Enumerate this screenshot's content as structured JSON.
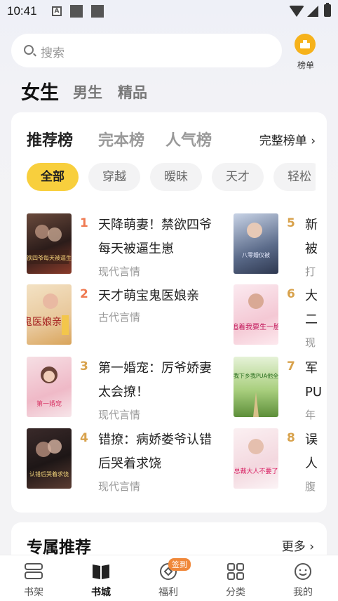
{
  "status": {
    "time": "10:41",
    "notif_a": "A"
  },
  "search": {
    "placeholder": "搜索"
  },
  "rank_button": {
    "label": "榜单"
  },
  "gender_tabs": [
    {
      "label": "女生",
      "active": true
    },
    {
      "label": "男生",
      "active": false
    },
    {
      "label": "精品",
      "active": false
    }
  ],
  "ranking": {
    "tabs": [
      {
        "label": "推荐榜",
        "active": true
      },
      {
        "label": "完本榜",
        "active": false
      },
      {
        "label": "人气榜",
        "active": false
      }
    ],
    "full_link": "完整榜单 ›",
    "chips": [
      {
        "label": "全部",
        "active": true
      },
      {
        "label": "穿越",
        "active": false
      },
      {
        "label": "暧昧",
        "active": false
      },
      {
        "label": "天才",
        "active": false
      },
      {
        "label": "轻松",
        "active": false
      }
    ],
    "books": [
      {
        "rank": "1",
        "title": "天降萌妻！禁欲四爷每天被逼生崽",
        "category": "现代言情",
        "cover_text": "禁欲四爷每天被逼生崽"
      },
      {
        "rank": "2",
        "title": "天才萌宝鬼医娘亲",
        "category": "古代言情",
        "cover_text": "鬼医娘亲"
      },
      {
        "rank": "3",
        "title": "第一婚宠：厉爷娇妻太会撩！",
        "category": "现代言情",
        "cover_text": "第一婚宠"
      },
      {
        "rank": "4",
        "title": "错撩：病娇娄爷认错后哭着求饶",
        "category": "现代言情",
        "cover_text": "认错后哭着求饶"
      },
      {
        "rank": "5",
        "title": "新",
        "title2": "被",
        "category": "打",
        "cover_text": "八零婚仪被"
      },
      {
        "rank": "6",
        "title": "大",
        "title2": "二",
        "category": "现",
        "cover_text": "追着我要生一胎"
      },
      {
        "rank": "7",
        "title": "军",
        "title2": "PU",
        "category": "年",
        "cover_text": "退我下乡我PUA他全家"
      },
      {
        "rank": "8",
        "title": "误",
        "title2": "人",
        "category": "腹",
        "cover_text": "总裁大人不要了"
      }
    ]
  },
  "exclusive": {
    "title": "专属推荐",
    "more": "更多 ›"
  },
  "bottom_nav": [
    {
      "label": "书架",
      "icon": "bookshelf-icon",
      "active": false
    },
    {
      "label": "书城",
      "icon": "book-open-icon",
      "active": true
    },
    {
      "label": "福利",
      "icon": "gift-icon",
      "active": false,
      "badge": "签到"
    },
    {
      "label": "分类",
      "icon": "grid-icon",
      "active": false
    },
    {
      "label": "我的",
      "icon": "profile-icon",
      "active": false
    }
  ],
  "colors": {
    "accent": "#f8cf3d",
    "rank_top": "#ef7a52",
    "rank_other": "#d8a24c",
    "badge": "#f0883a"
  }
}
